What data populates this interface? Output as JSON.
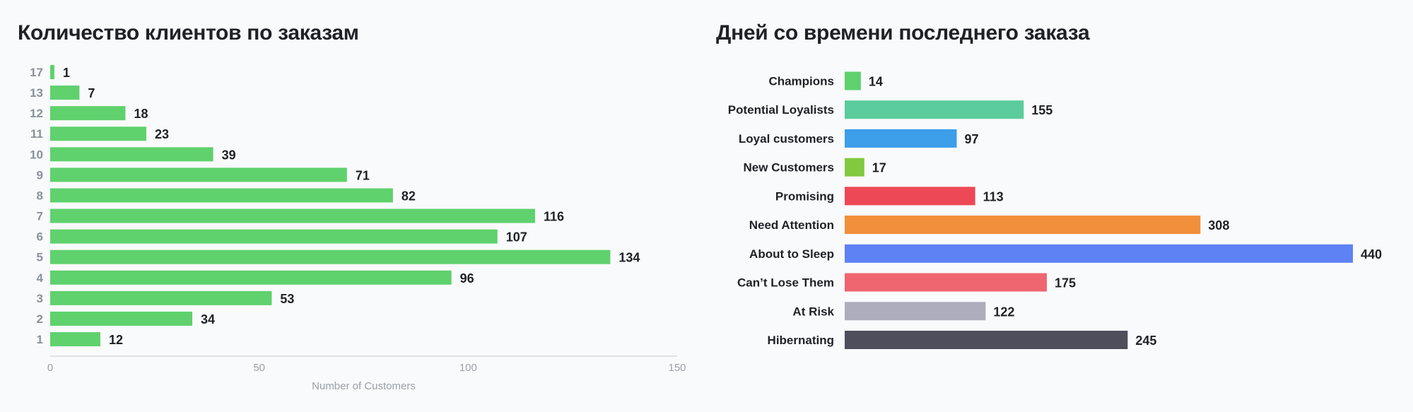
{
  "chart_data": [
    {
      "type": "bar",
      "orientation": "horizontal",
      "title": "Количество клиентов по заказам",
      "xlabel": "Number of Customers",
      "ylabel": "",
      "categories": [
        "17",
        "13",
        "12",
        "11",
        "10",
        "9",
        "8",
        "7",
        "6",
        "5",
        "4",
        "3",
        "2",
        "1"
      ],
      "values": [
        1,
        7,
        18,
        23,
        39,
        71,
        82,
        116,
        107,
        134,
        96,
        53,
        34,
        12
      ],
      "xlim": [
        0,
        150
      ],
      "xticks": [
        "0",
        "50",
        "100",
        "150"
      ],
      "grid": false,
      "color": "#5fd16d",
      "data_labels": true
    },
    {
      "type": "bar",
      "orientation": "horizontal",
      "title": "Дней со времени последнего заказа",
      "xlabel": "",
      "ylabel": "",
      "categories": [
        "Champions",
        "Potential Loyalists",
        "Loyal customers",
        "New Customers",
        "Promising",
        "Need Attention",
        "About to Sleep",
        "Can’t Lose Them",
        "At Risk",
        "Hibernating"
      ],
      "values": [
        14,
        155,
        97,
        17,
        113,
        308,
        440,
        175,
        122,
        245
      ],
      "colors": [
        "#5fd16d",
        "#5bcc9c",
        "#3d9ee9",
        "#82c93f",
        "#ed4856",
        "#f28f3b",
        "#5e81f4",
        "#ef6670",
        "#aeadbe",
        "#4e4e5c"
      ],
      "grid": false,
      "data_labels": true
    }
  ]
}
